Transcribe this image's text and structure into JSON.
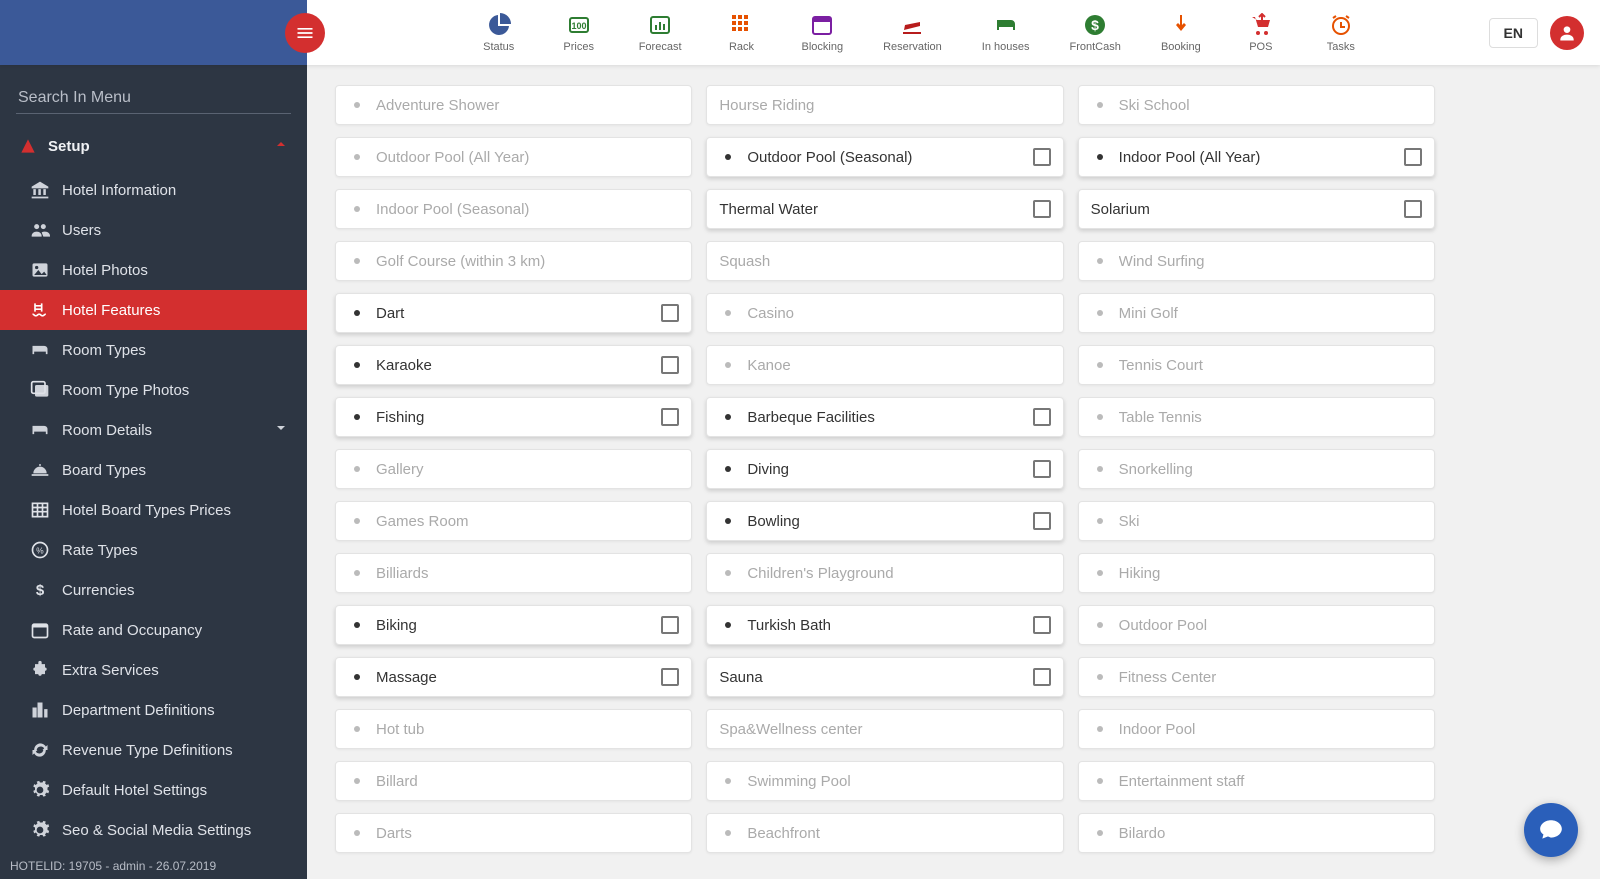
{
  "topnav": [
    {
      "key": "status",
      "label": "Status",
      "icon": "pie",
      "color": "#3b5998"
    },
    {
      "key": "prices",
      "label": "Prices",
      "icon": "price",
      "color": "#2e7d32"
    },
    {
      "key": "forecast",
      "label": "Forecast",
      "icon": "forecast",
      "color": "#2e7d32"
    },
    {
      "key": "rack",
      "label": "Rack",
      "icon": "grid",
      "color": "#e65100"
    },
    {
      "key": "blocking",
      "label": "Blocking",
      "icon": "calblock",
      "color": "#7b1fa2"
    },
    {
      "key": "reservation",
      "label": "Reservation",
      "icon": "arrive",
      "color": "#b71c1c"
    },
    {
      "key": "inhouses",
      "label": "In houses",
      "icon": "bed",
      "color": "#2e7d32"
    },
    {
      "key": "frontcash",
      "label": "FrontCash",
      "icon": "dollar",
      "color": "#2e7d32"
    },
    {
      "key": "booking",
      "label": "Booking",
      "icon": "touch",
      "color": "#e65100"
    },
    {
      "key": "pos",
      "label": "POS",
      "icon": "cart",
      "color": "#d32f2f"
    },
    {
      "key": "tasks",
      "label": "Tasks",
      "icon": "alarm",
      "color": "#e65100"
    }
  ],
  "lang_label": "EN",
  "search": {
    "placeholder": "Search In Menu"
  },
  "setup_label": "Setup",
  "sidebar": [
    {
      "key": "hotel-information",
      "label": "Hotel Information",
      "icon": "bank"
    },
    {
      "key": "users",
      "label": "Users",
      "icon": "people"
    },
    {
      "key": "hotel-photos",
      "label": "Hotel Photos",
      "icon": "image"
    },
    {
      "key": "hotel-features",
      "label": "Hotel Features",
      "icon": "pool",
      "active": true
    },
    {
      "key": "room-types",
      "label": "Room Types",
      "icon": "bed"
    },
    {
      "key": "room-type-photos",
      "label": "Room Type Photos",
      "icon": "photolib"
    },
    {
      "key": "room-details",
      "label": "Room Details",
      "icon": "bed",
      "expandable": true
    },
    {
      "key": "board-types",
      "label": "Board Types",
      "icon": "cloche"
    },
    {
      "key": "hotel-board-types-prices",
      "label": "Hotel Board Types Prices",
      "icon": "table"
    },
    {
      "key": "rate-types",
      "label": "Rate Types",
      "icon": "rate"
    },
    {
      "key": "currencies",
      "label": "Currencies",
      "icon": "money"
    },
    {
      "key": "rate-and-occupancy",
      "label": "Rate and Occupancy",
      "icon": "calendar"
    },
    {
      "key": "extra-services",
      "label": "Extra Services",
      "icon": "puzzle"
    },
    {
      "key": "department-definitions",
      "label": "Department Definitions",
      "icon": "city"
    },
    {
      "key": "revenue-type-definitions",
      "label": "Revenue Type Definitions",
      "icon": "sync"
    },
    {
      "key": "default-hotel-settings",
      "label": "Default Hotel Settings",
      "icon": "gear"
    },
    {
      "key": "seo-social",
      "label": "Seo & Social Media Settings",
      "icon": "gear"
    }
  ],
  "footer_status": "HOTELID: 19705 - admin - 26.07.2019",
  "features": [
    {
      "label": "Adventure Shower",
      "icon": "shower",
      "enabled": false
    },
    {
      "label": "Hourse Riding",
      "icon": "none",
      "enabled": false
    },
    {
      "label": "Ski School",
      "icon": "ski",
      "enabled": false
    },
    {
      "label": "Outdoor Pool (All Year)",
      "icon": "pool",
      "enabled": false
    },
    {
      "label": "Outdoor Pool (Seasonal)",
      "icon": "pool",
      "enabled": true
    },
    {
      "label": "Indoor Pool (All Year)",
      "icon": "pool",
      "enabled": true
    },
    {
      "label": "Indoor Pool (Seasonal)",
      "icon": "pool",
      "enabled": false
    },
    {
      "label": "Thermal Water",
      "icon": "none",
      "enabled": true
    },
    {
      "label": "Solarium",
      "icon": "none",
      "enabled": true
    },
    {
      "label": "Golf Course (within 3 km)",
      "icon": "golf",
      "enabled": false
    },
    {
      "label": "Squash",
      "icon": "none",
      "enabled": false
    },
    {
      "label": "Wind Surfing",
      "icon": "wind",
      "enabled": false
    },
    {
      "label": "Dart",
      "icon": "dart",
      "enabled": true
    },
    {
      "label": "Casino",
      "icon": "casino",
      "enabled": false
    },
    {
      "label": "Mini Golf",
      "icon": "golf",
      "enabled": false
    },
    {
      "label": "Karaoke",
      "icon": "mic",
      "enabled": true
    },
    {
      "label": "Kanoe",
      "icon": "kanoe",
      "enabled": false
    },
    {
      "label": "Tennis Court",
      "icon": "tennis",
      "enabled": false
    },
    {
      "label": "Fishing",
      "icon": "fish",
      "enabled": true
    },
    {
      "label": "Barbeque Facilities",
      "icon": "bbq",
      "enabled": true
    },
    {
      "label": "Table Tennis",
      "icon": "tabletennis",
      "enabled": false
    },
    {
      "label": "Gallery",
      "icon": "gallery",
      "enabled": false
    },
    {
      "label": "Diving",
      "icon": "dive",
      "enabled": true
    },
    {
      "label": "Snorkelling",
      "icon": "snorkel",
      "enabled": false
    },
    {
      "label": "Games Room",
      "icon": "games",
      "enabled": false
    },
    {
      "label": "Bowling",
      "icon": "bowl",
      "enabled": true
    },
    {
      "label": "Ski",
      "icon": "ski",
      "enabled": false
    },
    {
      "label": "Billiards",
      "icon": "circle",
      "enabled": false
    },
    {
      "label": "Children's Playground",
      "icon": "gamepad",
      "enabled": false
    },
    {
      "label": "Hiking",
      "icon": "hike",
      "enabled": false
    },
    {
      "label": "Biking",
      "icon": "bike",
      "enabled": true
    },
    {
      "label": "Turkish Bath",
      "icon": "spa",
      "enabled": true
    },
    {
      "label": "Outdoor Pool",
      "icon": "pool",
      "enabled": false
    },
    {
      "label": "Massage",
      "icon": "massage",
      "enabled": true
    },
    {
      "label": "Sauna",
      "icon": "none",
      "enabled": true
    },
    {
      "label": "Fitness Center",
      "icon": "fitness",
      "enabled": false
    },
    {
      "label": "Hot tub",
      "icon": "hottub",
      "enabled": false
    },
    {
      "label": "Spa&Wellness center",
      "icon": "none",
      "enabled": false
    },
    {
      "label": "Indoor Pool",
      "icon": "pool",
      "enabled": false
    },
    {
      "label": "Billard",
      "icon": "circle",
      "enabled": false
    },
    {
      "label": "Swimming Pool",
      "icon": "pool",
      "enabled": false
    },
    {
      "label": "Entertainment staff",
      "icon": "people",
      "enabled": false
    },
    {
      "label": "Darts",
      "icon": "dart",
      "enabled": false
    },
    {
      "label": "Beachfront",
      "icon": "beach",
      "enabled": false
    },
    {
      "label": "Bilardo",
      "icon": "circle",
      "enabled": false
    }
  ]
}
